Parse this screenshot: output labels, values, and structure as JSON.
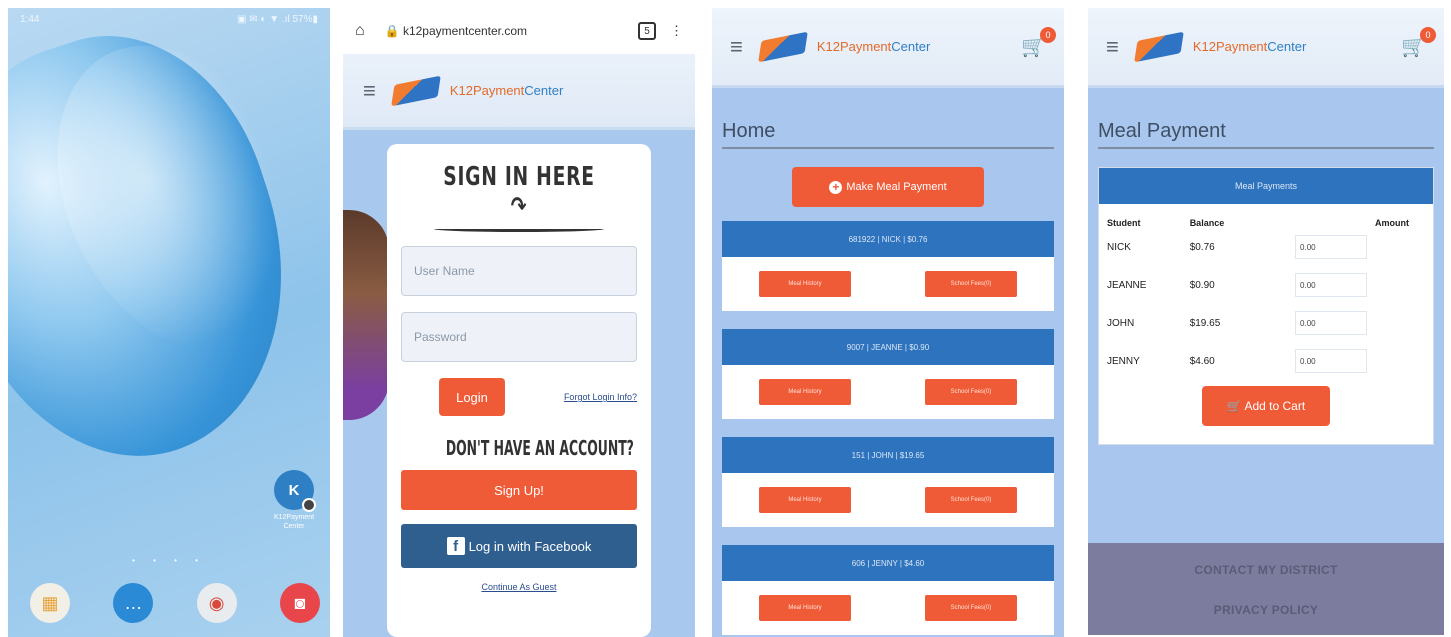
{
  "android": {
    "status_time": "1:44",
    "status_icons": "▣ ✉ ◐ ▼ .ıl 57%▮",
    "app_icon_letter": "K",
    "app_label": "K12Payment Center",
    "page_dots": "• • • •",
    "dock": [
      {
        "icon": "apps-folder-icon",
        "glyph": "▦",
        "color": "#e8c64a"
      },
      {
        "icon": "messages-icon",
        "glyph": "…",
        "color": "#2a8ad6"
      },
      {
        "icon": "chrome-icon",
        "glyph": "◉",
        "color": "#e24a3b"
      },
      {
        "icon": "camera-icon",
        "glyph": "◙",
        "color": "#e8464a"
      }
    ]
  },
  "browser": {
    "home_glyph": "⌂",
    "url": "🔒 k12paymentcenter.com",
    "tabs_count": "5",
    "menu_glyph": "⋮"
  },
  "brand": {
    "name_a": "K12Payment",
    "name_b": "Center",
    "hamburger": "≡"
  },
  "login": {
    "title": "SIGN IN HERE ↷",
    "username_placeholder": "User Name",
    "password_placeholder": "Password",
    "login_button": "Login",
    "forgot_link": "Forgot Login Info?",
    "no_account": "DON'T HAVE AN ACCOUNT?",
    "signup_button": "Sign Up!",
    "facebook_button": "Log in with Facebook",
    "facebook_glyph": "f",
    "guest_link": "Continue As Guest"
  },
  "home": {
    "cart_glyph": "🛒",
    "cart_count": "0",
    "heading": "Home",
    "make_payment_button": "Make Meal Payment",
    "students": [
      {
        "header": "681922 | NICK | $0.76",
        "history": "Meal History",
        "fees": "School Fees(0)"
      },
      {
        "header": "9007 | JEANNE | $0.90",
        "history": "Meal History",
        "fees": "School Fees(0)"
      },
      {
        "header": "151 | JOHN | $19.65",
        "history": "Meal History",
        "fees": "School Fees(0)"
      },
      {
        "header": "606 | JENNY | $4.60",
        "history": "Meal History",
        "fees": "School Fees(0)"
      }
    ]
  },
  "meal": {
    "heading": "Meal Payment",
    "card_title": "Meal Payments",
    "col_student": "Student",
    "col_balance": "Balance",
    "col_amount": "Amount",
    "rows": [
      {
        "student": "NICK",
        "balance": "$0.76",
        "amount": "0.00"
      },
      {
        "student": "JEANNE",
        "balance": "$0.90",
        "amount": "0.00"
      },
      {
        "student": "JOHN",
        "balance": "$19.65",
        "amount": "0.00"
      },
      {
        "student": "JENNY",
        "balance": "$4.60",
        "amount": "0.00"
      }
    ],
    "add_to_cart": "🛒 Add to Cart",
    "footer_contact": "CONTACT MY DISTRICT",
    "footer_privacy": "PRIVACY POLICY"
  }
}
